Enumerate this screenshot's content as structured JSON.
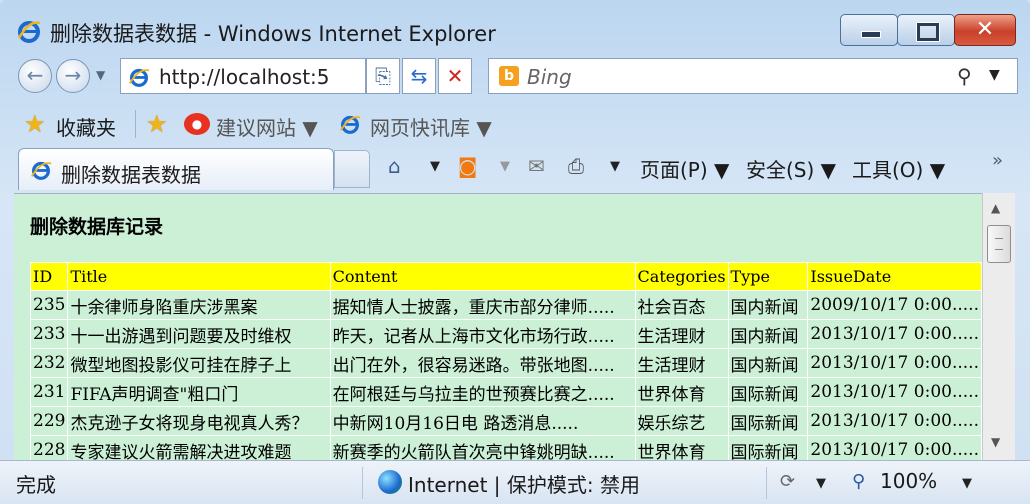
{
  "window": {
    "title": "删除数据表数据 - Windows Internet Explorer",
    "minimize_glyph": "▁",
    "maximize_glyph": "☐",
    "close_glyph": "✕"
  },
  "address": {
    "url": "http://localhost:5"
  },
  "search": {
    "placeholder": "Bing"
  },
  "favorites": {
    "label": "收藏夹",
    "items": [
      "建议网站",
      "网页快讯库"
    ]
  },
  "tab": {
    "title": "删除数据表数据"
  },
  "commands": {
    "page": "页面(P)",
    "safety": "安全(S)",
    "tools": "工具(O)"
  },
  "content": {
    "heading": "删除数据库记录",
    "columns": [
      "ID",
      "Title",
      "Content",
      "Categories",
      "Type",
      "IssueDate"
    ],
    "rows": [
      [
        "235",
        "十余律师身陷重庆涉黑案",
        "据知情人士披露，重庆市部分律师.....",
        "社会百态",
        "国内新闻",
        "2009/10/17 0:00....."
      ],
      [
        "233",
        "十一出游遇到问题要及时维权",
        "昨天，记者从上海市文化市场行政.....",
        "生活理财",
        "国内新闻",
        "2013/10/17 0:00....."
      ],
      [
        "232",
        "微型地图投影仪可挂在脖子上",
        "出门在外，很容易迷路。带张地图.....",
        "生活理财",
        "国内新闻",
        "2013/10/17 0:00....."
      ],
      [
        "231",
        "FIFA声明调查\"粗口门",
        "在阿根廷与乌拉圭的世预赛比赛之.....",
        "世界体育",
        "国际新闻",
        "2013/10/17 0:00....."
      ],
      [
        "229",
        "杰克逊子女将现身电视真人秀？",
        "中新网10月16日电 路透消息.....",
        "娱乐综艺",
        "国际新闻",
        "2013/10/17 0:00....."
      ],
      [
        "228",
        "专家建议火箭需解决进攻难题",
        "新赛季的火箭队首次亮中锋姚明缺.....",
        "世界体育",
        "国际新闻",
        "2013/10/17 0:00....."
      ]
    ]
  },
  "status": {
    "text": "完成",
    "zone": "Internet | 保护模式: 禁用",
    "zoom": "100%"
  }
}
